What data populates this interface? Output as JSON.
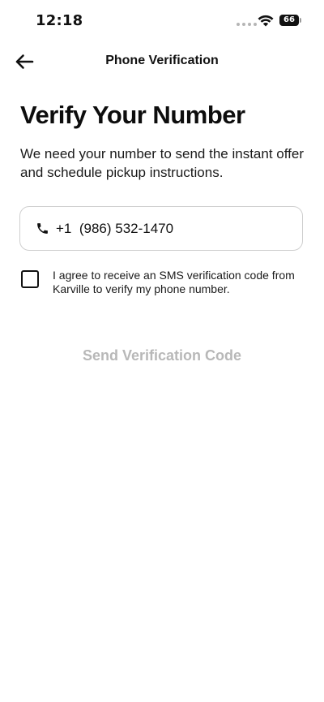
{
  "status_bar": {
    "time": "12:18",
    "battery": "66"
  },
  "header": {
    "title": "Phone Verification"
  },
  "main": {
    "title": "Verify Your Number",
    "description": "We need your number to send the instant offer and schedule pickup instructions.",
    "phone_field": {
      "value": "+1  (986) 532-1470",
      "icon": "phone-icon"
    },
    "consent": {
      "checked": false,
      "text": "I agree to receive an SMS verification code from Karville to verify my phone number."
    },
    "send_button_label": "Send Verification Code",
    "send_button_color": "#b8b8b8"
  },
  "icons": {
    "back": "arrow-left-icon",
    "wifi": "wifi-icon"
  }
}
